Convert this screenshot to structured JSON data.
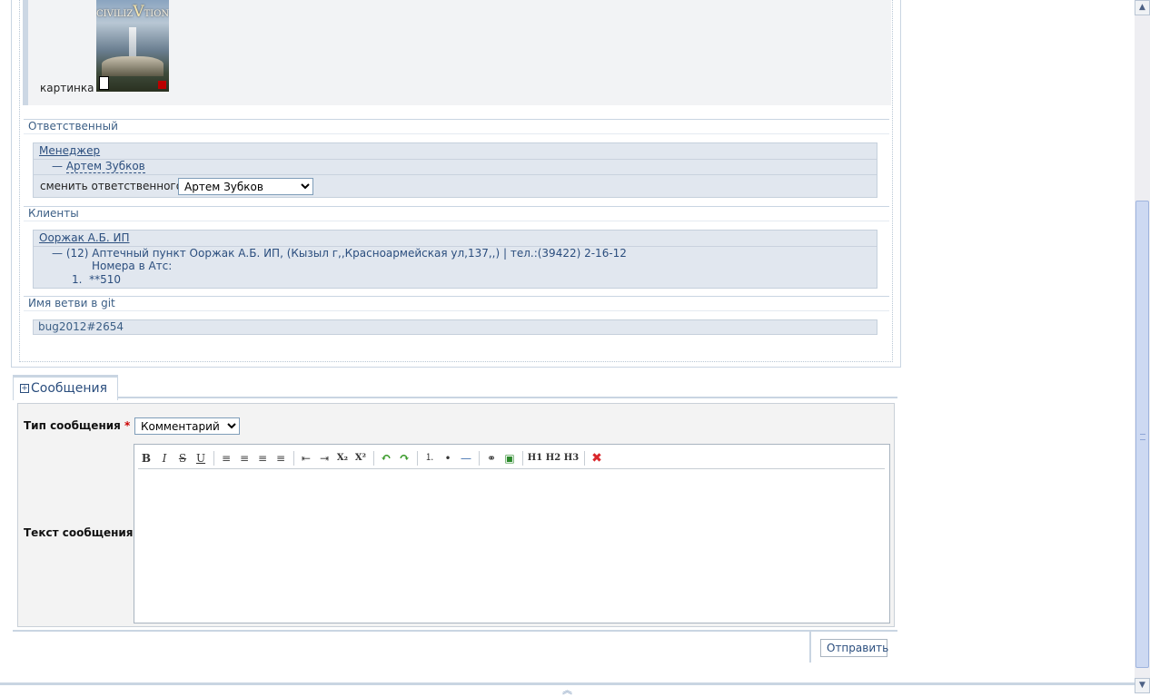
{
  "attachment": {
    "label": "картинка",
    "image_logo": "CIVILIZATION V"
  },
  "responsible": {
    "section_title": "Ответственный",
    "group": "Менеджер",
    "person": "— Артем Зубков",
    "change_label": "сменить ответственного:",
    "selected": "Артем Зубков"
  },
  "clients": {
    "section_title": "Клиенты",
    "name": "Ооржак А.Б. ИП",
    "detail": "— (12) Аптечный пункт Ооржак А.Б. ИП, (Кызыл г,,Красноармейская ул,137,,) | тел.:(39422) 2-16-12",
    "ats_label": "Номера в Атс:",
    "ats_items": [
      "1.  **510"
    ]
  },
  "git": {
    "section_title": "Имя ветви в git",
    "branch": "bug2012#2654"
  },
  "messages_tab": {
    "title": "Сообщения",
    "toggle": "+"
  },
  "form": {
    "type_label": "Тип сообщения",
    "required_mark": "*",
    "type_selected": "Комментарий",
    "text_label": "Текст сообщения",
    "toolbar": {
      "bold": "B",
      "italic": "I",
      "strike": "S",
      "underline": "U",
      "align_left": "≡",
      "align_center": "≡",
      "align_right": "≡",
      "align_justify": "≡",
      "outdent": "⇤",
      "indent": "⇥",
      "subscript": "X₂",
      "superscript": "X²",
      "undo": "↶",
      "redo": "↷",
      "ordered_list": "⒈",
      "unordered_list": "•",
      "hr": "—",
      "link": "⚭",
      "image": "▣",
      "h1": "H1",
      "h2": "H2",
      "h3": "H3",
      "remove": "✖"
    },
    "submit_label": "Отправить"
  },
  "colors": {
    "accent": "#2b4e7e",
    "border": "#c9d5e2",
    "panel": "#e1e7ef",
    "remove_icon": "#d9262b",
    "undo_redo": "#3a9a2a"
  },
  "bottom_bar": {
    "collapse_icon": "»"
  },
  "scrollbar": {
    "up": "▲",
    "down": "▼"
  }
}
